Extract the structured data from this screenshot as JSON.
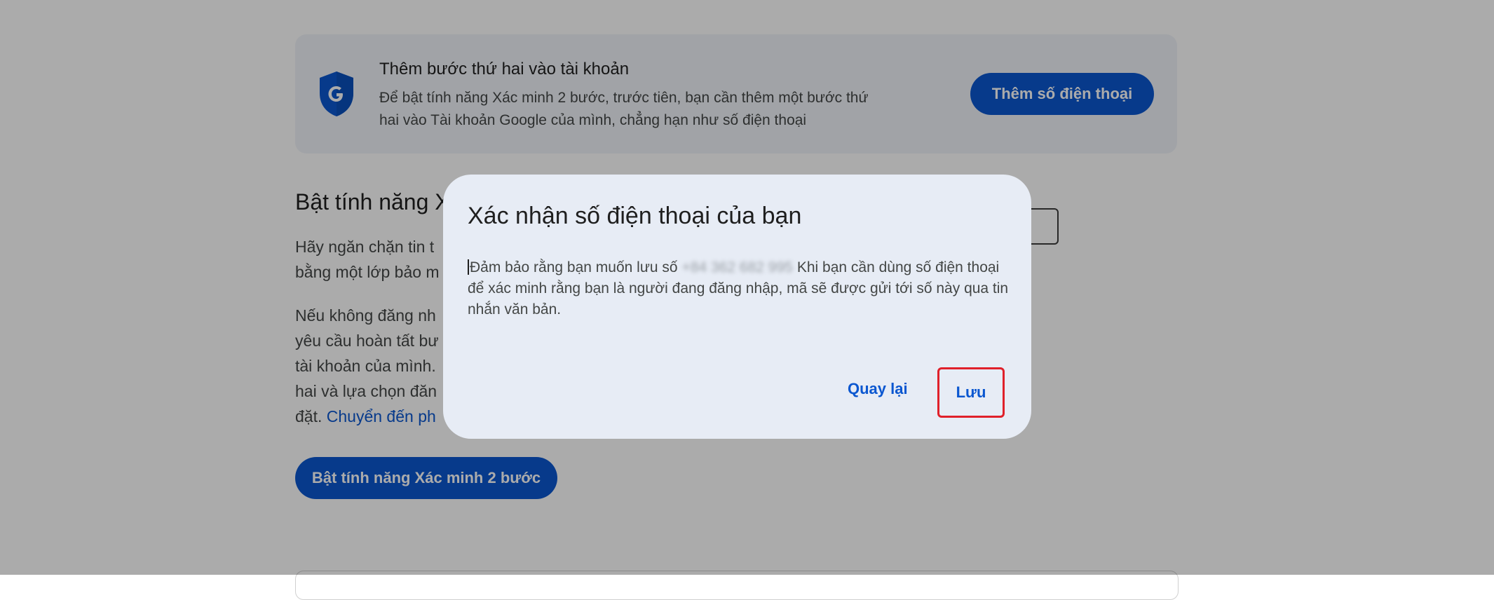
{
  "banner": {
    "title": "Thêm bước thứ hai vào tài khoản",
    "description": "Để bật tính năng Xác minh 2 bước, trước tiên, bạn cần thêm một bước thứ hai vào Tài khoản Google của mình, chẳng hạn như số điện thoại",
    "add_phone_button": "Thêm số điện thoại",
    "icon": "google-shield-icon"
  },
  "section": {
    "title_visible": "Bật tính năng X",
    "para1_line1": "Hãy ngăn chặn tin t",
    "para1_line2": "bằng một lớp bảo m",
    "para2_line1": "Nếu không đăng nh",
    "para2_line2": "yêu cầu hoàn tất bư",
    "para2_line3": "tài khoản của mình.",
    "para2_line4": "hai và lựa chọn đăn",
    "para2_line5_prefix": "đặt. ",
    "para2_link": "Chuyển đến ph",
    "enable_button": "Bật tính năng Xác minh 2 bước"
  },
  "dialog": {
    "title": "Xác nhận số điện thoại của bạn",
    "body_prefix": "Đảm bảo rằng bạn muốn lưu số",
    "phone_blurred": "+84 362 682 995",
    "body_suffix": "Khi bạn cần dùng số điện thoại để xác minh rằng bạn là người đang đăng nhập, mã sẽ được gửi tới số này qua tin nhắn văn bản.",
    "back_button": "Quay lại",
    "save_button": "Lưu"
  },
  "colors": {
    "primary": "#0b57d0",
    "highlight": "#e0202a",
    "dialog_bg": "#e7ecf5"
  }
}
